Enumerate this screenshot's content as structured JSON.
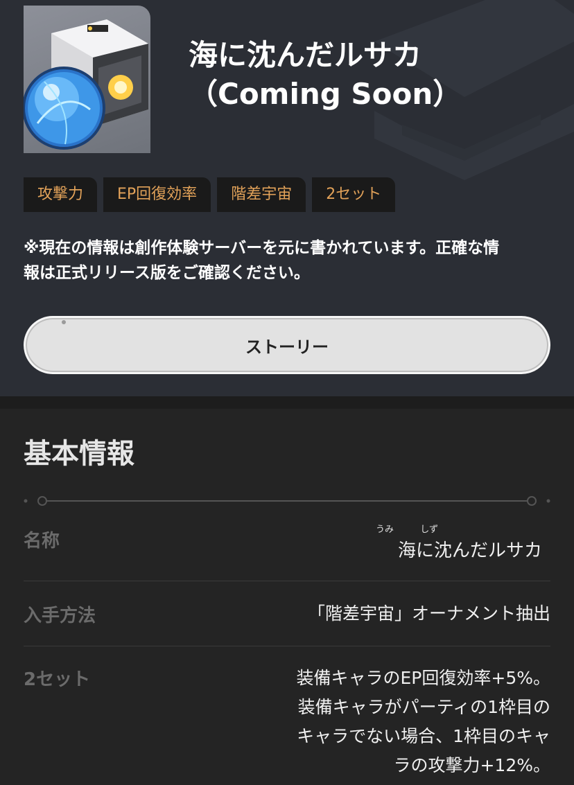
{
  "header": {
    "title": "海に沈んだルサカ（Coming Soon）",
    "thumbnail_icon": "planar-ornament-icon",
    "tags": [
      "攻撃力",
      "EP回復効率",
      "階差宇宙",
      "2セット"
    ],
    "notice": "※現在の情報は創作体験サーバーを元に書かれています。正確な情報は正式リリース版をご確認ください。",
    "story_button": "ストーリー"
  },
  "basic_info": {
    "section_title": "基本情報",
    "name": {
      "label": "名称",
      "value": "海に沈んだルサカ",
      "ruby": [
        "うみ",
        "しず"
      ]
    },
    "acquisition": {
      "label": "入手方法",
      "value": "「階差宇宙」オーナメント抽出"
    },
    "set2": {
      "label": "2セット",
      "lines": [
        "装備キャラのEP回復効率+5%。",
        "装備キャラがパーティの1枠目の",
        "キャラでない場合、1枠目のキャ",
        "ラの攻撃力+12%。"
      ]
    }
  },
  "colors": {
    "header_bg": "#2b2e35",
    "body_bg": "#242424",
    "tag_text": "#e2a259",
    "tag_bg": "#1a1a1a",
    "label_gray": "#6b6b6b"
  }
}
